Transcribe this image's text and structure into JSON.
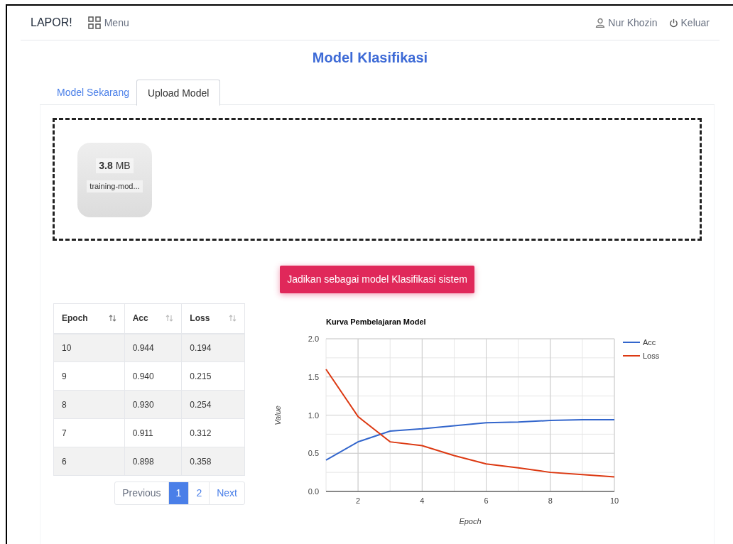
{
  "navbar": {
    "brand": "LAPOR!",
    "menu": "Menu",
    "user": "Nur Khozin",
    "logout": "Keluar"
  },
  "page_title": "Model Klasifikasi",
  "tabs": [
    {
      "label": "Model Sekarang",
      "selected": false
    },
    {
      "label": "Upload Model",
      "selected": true
    }
  ],
  "dropzone": {
    "files": [
      {
        "size_value": "3.8",
        "size_unit": "MB",
        "name": "training-mod..."
      }
    ]
  },
  "submit_button": "Jadikan sebagai model Klasifikasi sistem",
  "table": {
    "columns": [
      "Epoch",
      "Acc",
      "Loss"
    ],
    "rows": [
      [
        "10",
        "0.944",
        "0.194"
      ],
      [
        "9",
        "0.940",
        "0.215"
      ],
      [
        "8",
        "0.930",
        "0.254"
      ],
      [
        "7",
        "0.911",
        "0.312"
      ],
      [
        "6",
        "0.898",
        "0.358"
      ]
    ]
  },
  "pagination": [
    {
      "label": "Previous",
      "selected": false,
      "disabled": true
    },
    {
      "label": "1",
      "selected": true,
      "disabled": false
    },
    {
      "label": "2",
      "selected": false,
      "disabled": false
    },
    {
      "label": "Next",
      "selected": false,
      "disabled": false
    }
  ],
  "chart_data": {
    "type": "line",
    "title": "Kurva Pembelajaran Model",
    "xlabel": "Epoch",
    "ylabel": "Value",
    "x": [
      1,
      2,
      3,
      4,
      5,
      6,
      7,
      8,
      9,
      10
    ],
    "series": [
      {
        "name": "Acc",
        "color": "#3366cc",
        "values": [
          0.41,
          0.65,
          0.79,
          0.82,
          0.86,
          0.9,
          0.91,
          0.93,
          0.94,
          0.94
        ]
      },
      {
        "name": "Loss",
        "color": "#dc3912",
        "values": [
          1.6,
          0.98,
          0.65,
          0.6,
          0.47,
          0.36,
          0.31,
          0.25,
          0.22,
          0.19
        ]
      }
    ],
    "grid": true,
    "legend": true,
    "xlim": [
      1,
      10
    ],
    "ylim": [
      0,
      2
    ],
    "xticks": [
      {
        "value": 2,
        "label": "2"
      },
      {
        "value": 4,
        "label": "4"
      },
      {
        "value": 6,
        "label": "6"
      },
      {
        "value": 8,
        "label": "8"
      },
      {
        "value": 10,
        "label": "10"
      }
    ],
    "yticks": [
      {
        "value": 0,
        "label": "0.0"
      },
      {
        "value": 0.5,
        "label": "0.5"
      },
      {
        "value": 1,
        "label": "1.0"
      },
      {
        "value": 1.5,
        "label": "1.5"
      },
      {
        "value": 2,
        "label": "2.0"
      }
    ]
  }
}
